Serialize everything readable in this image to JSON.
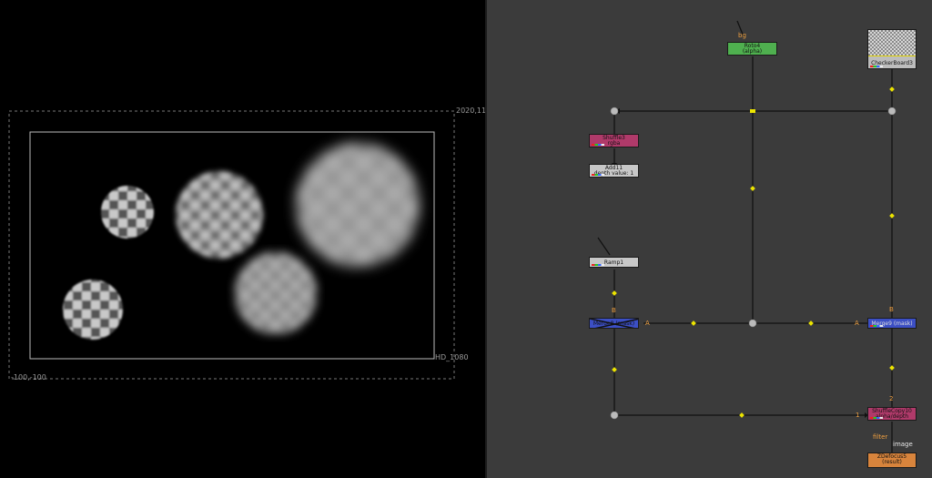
{
  "viewer": {
    "format_top_right": "2020,11",
    "format_bottom_left": "-100,-100",
    "format_name": "HD_1080"
  },
  "graph": {
    "nodes": {
      "roto4": {
        "name": "Roto4",
        "sub": "(alpha)",
        "color": "#4fb04f"
      },
      "checkerboard3": {
        "name": "CheckerBoard3"
      },
      "shuffle3": {
        "name": "Shuffle3",
        "sub": "rgba",
        "color": "#b03a6a"
      },
      "add11": {
        "name": "Add11",
        "sub": "depth value: 1",
        "color": "#c8c8c8"
      },
      "ramp1": {
        "name": "Ramp1",
        "color": "#c8c8c8"
      },
      "merge_disabled": {
        "name": "Merge8 (mask)",
        "color": "#3c4fc4"
      },
      "merge_mask": {
        "name": "Merge9 (mask)",
        "color": "#3c4fc4"
      },
      "shufflecopy10": {
        "name": "ShuffleCopy10",
        "sub": "alpha/depth",
        "color": "#b03a6a"
      },
      "zdefocus5": {
        "name": "ZDefocus5",
        "sub": "(result)",
        "color": "#d8843c"
      }
    },
    "labels": {
      "bg": "bg",
      "merge_left_b": "B",
      "merge_left_a": "A",
      "merge_right_a": "A",
      "merge_right_b": "B",
      "shufflecopy_in2": "2",
      "shufflecopy_in1": "1",
      "filter": "filter",
      "image": "image"
    }
  }
}
